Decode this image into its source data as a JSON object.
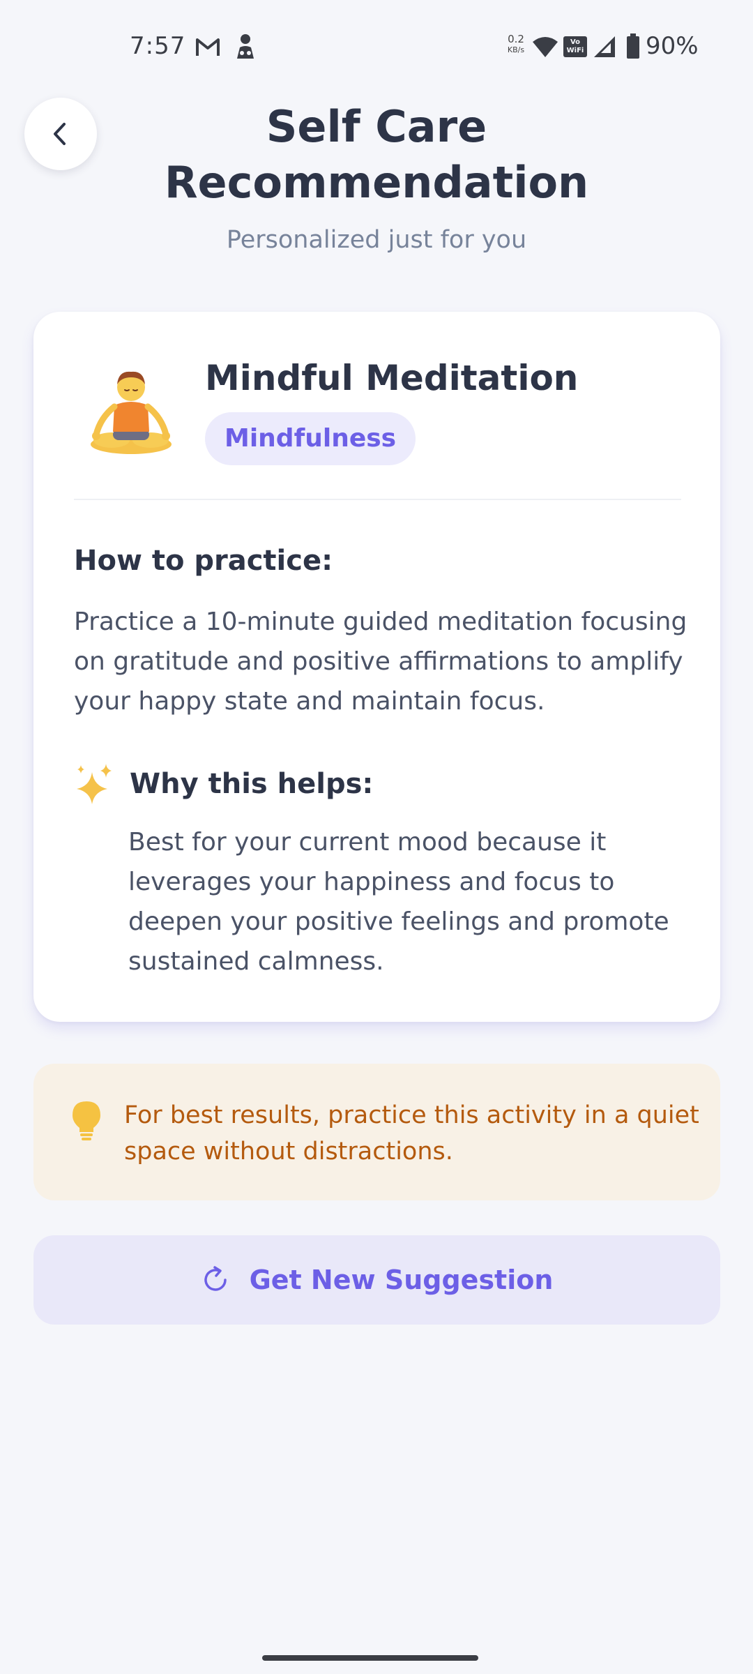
{
  "status_bar": {
    "time": "7:57",
    "net_speed_value": "0.2",
    "net_speed_unit": "KB/s",
    "vowifi_label_1": "Vo",
    "vowifi_label_2": "WiFi",
    "battery_percent": "90%",
    "icons": [
      "gmail-icon",
      "incognito-icon",
      "wifi-icon",
      "vowifi-icon",
      "cellular-signal-icon",
      "battery-icon"
    ]
  },
  "header": {
    "back_icon": "chevron-left-icon",
    "title_line1": "Self Care",
    "title_line2": "Recommendation",
    "subtitle": "Personalized just for you"
  },
  "recommendation": {
    "emoji_icon": "person-in-lotus-position-icon",
    "title": "Mindful Meditation",
    "category": "Mindfulness",
    "how_heading": "How to practice:",
    "how_text": "Practice a 10-minute guided meditation focusing on gratitude and positive affirmations to amplify your happy state and maintain focus.",
    "why_icon": "sparkles-icon",
    "why_heading": "Why this helps:",
    "why_text": "Best for your current mood because it leverages your happiness and focus to deepen your positive feelings and promote sustained calmness."
  },
  "tip": {
    "icon": "lightbulb-icon",
    "text": "For best results, practice this activity in a quiet space without distractions."
  },
  "actions": {
    "new_suggestion_icon": "refresh-icon",
    "new_suggestion_label": "Get New Suggestion"
  },
  "colors": {
    "background": "#f5f6fa",
    "accent": "#6c5fe6",
    "title_text": "#2d3447",
    "tip_background": "#f8f1e6",
    "tip_text": "#b45a0e",
    "lightbulb": "#f5c242"
  }
}
